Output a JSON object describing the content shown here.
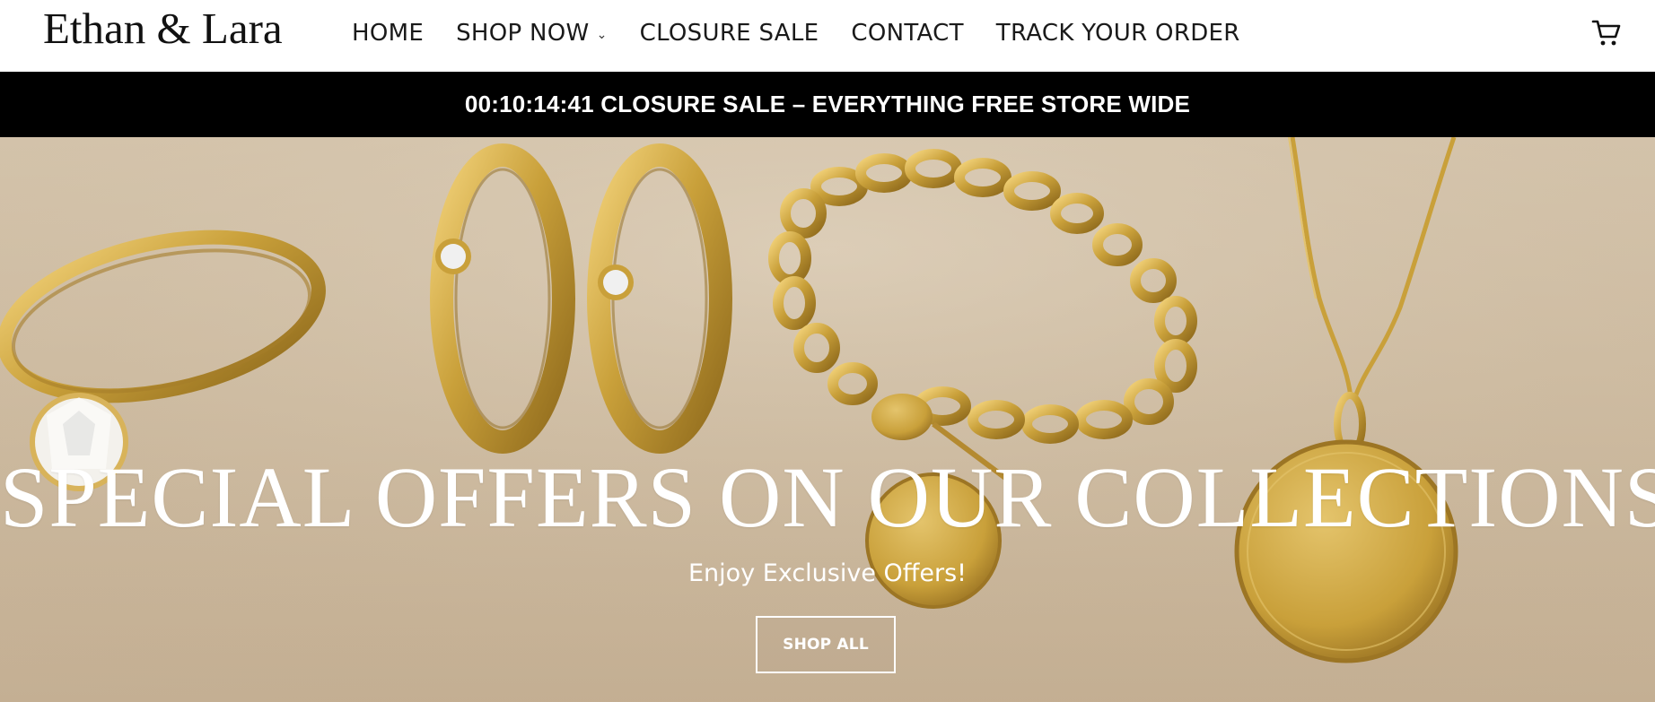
{
  "header": {
    "logo": "Ethan & Lara",
    "nav": [
      {
        "label": "HOME"
      },
      {
        "label": "SHOP NOW",
        "has_dropdown": true
      },
      {
        "label": "CLOSURE SALE"
      },
      {
        "label": "CONTACT"
      },
      {
        "label": "TRACK YOUR ORDER"
      }
    ],
    "cart_icon": "cart-icon",
    "dropdown_icon": "chevron-down-icon"
  },
  "announcement": {
    "countdown": "00:10:14:41",
    "message": "CLOSURE SALE – EVERYTHING FREE STORE WIDE",
    "background": "#000000",
    "color": "#ffffff"
  },
  "hero": {
    "title": "SPECIAL OFFERS ON OUR COLLECTIONS",
    "subtitle": "Enjoy Exclusive Offers!",
    "cta_label": "SHOP ALL",
    "gold": "#c9a03a",
    "background": "#d2c1a7"
  }
}
